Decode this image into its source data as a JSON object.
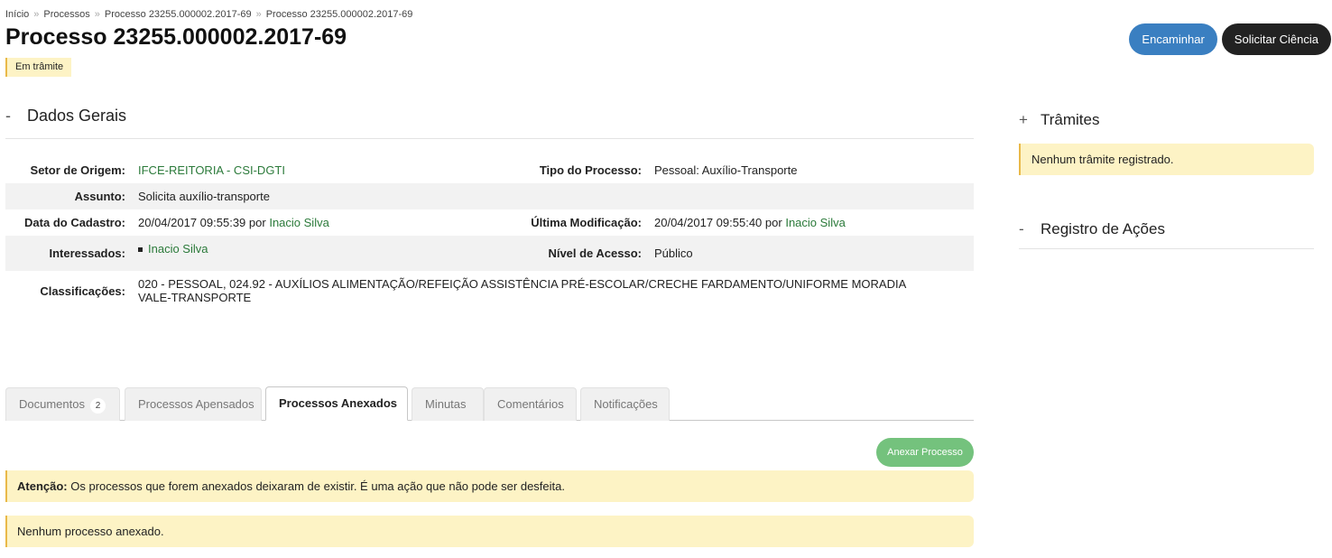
{
  "breadcrumb": [
    "Início",
    "Processos",
    "Processo 23255.000002.2017-69",
    "Processo 23255.000002.2017-69"
  ],
  "page_title": "Processo 23255.000002.2017-69",
  "status_badge": "Em trâmite",
  "actions": {
    "forward": "Encaminhar",
    "request_acknowledgment": "Solicitar Ciência"
  },
  "dados_gerais": {
    "toggle": "-",
    "title": "Dados Gerais",
    "setor_origem": {
      "label": "Setor de Origem:",
      "value": "IFCE-REITORIA - CSI-DGTI"
    },
    "tipo_processo": {
      "label": "Tipo do Processo:",
      "value": "Pessoal: Auxílio-Transporte"
    },
    "assunto": {
      "label": "Assunto:",
      "value": "Solicita auxílio-transporte"
    },
    "data_cadastro": {
      "label": "Data do Cadastro:",
      "value": "20/04/2017 09:55:39",
      "by": "por",
      "user": "Inacio Silva"
    },
    "ultima_modificacao": {
      "label": "Última Modificação:",
      "value": "20/04/2017 09:55:40",
      "by": "por",
      "user": "Inacio Silva"
    },
    "interessados": {
      "label": "Interessados:",
      "value": "Inacio Silva"
    },
    "nivel_acesso": {
      "label": "Nível de Acesso:",
      "value": "Público"
    },
    "classificacoes": {
      "label": "Classificações:",
      "line1": "020 - PESSOAL, 024.92 - AUXÍLIOS ALIMENTAÇÃO/REFEIÇÃO ASSISTÊNCIA PRÉ-ESCOLAR/CRECHE FARDAMENTO/UNIFORME MORADIA",
      "line2": "VALE-TRANSPORTE"
    }
  },
  "tabs": [
    {
      "label": "Documentos",
      "count": "2"
    },
    {
      "label": "Processos Apensados"
    },
    {
      "label": "Processos Anexados"
    },
    {
      "label": "Minutas"
    },
    {
      "label": "Comentários"
    },
    {
      "label": "Notificações"
    }
  ],
  "anexar_button": "Anexar Processo",
  "warning": {
    "strong": "Atenção:",
    "text": " Os processos que forem anexados deixaram de existir. É uma ação que não pode ser desfeita."
  },
  "empty_annexed": "Nenhum processo anexado.",
  "tramites": {
    "toggle": "+",
    "title": "Trâmites",
    "empty": "Nenhum trâmite registrado."
  },
  "registro_acoes": {
    "toggle": "-",
    "title": "Registro de Ações"
  }
}
